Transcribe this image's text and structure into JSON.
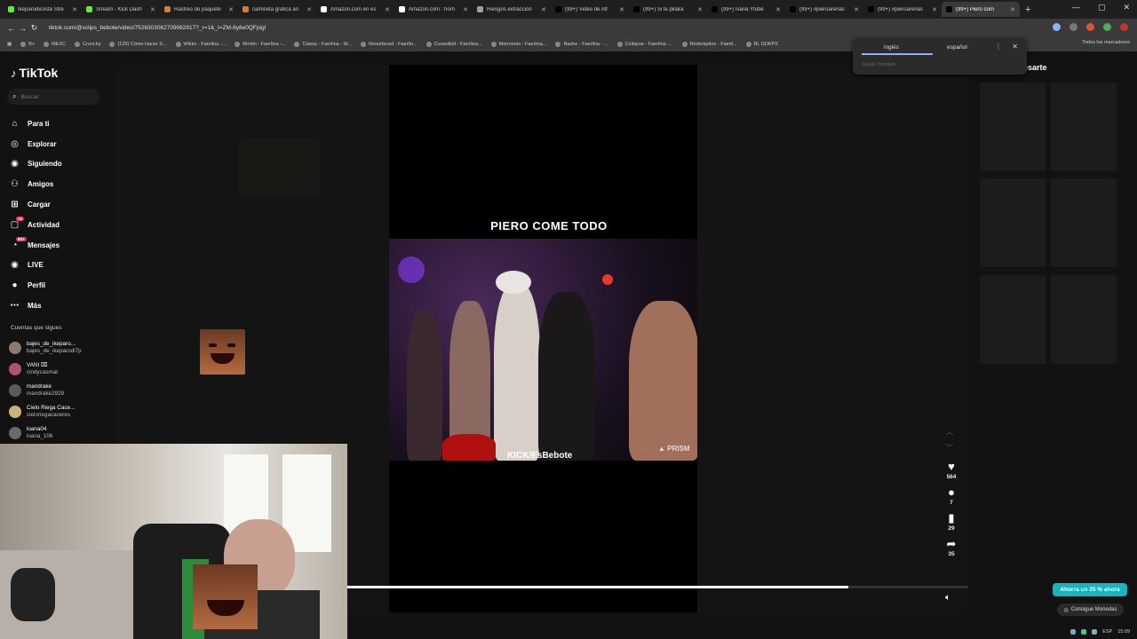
{
  "browser": {
    "tabs": [
      {
        "title": "Ikeparodicosta Stre",
        "color": "#53fc18"
      },
      {
        "title": "Stream - Kick Dash",
        "color": "#53fc18"
      },
      {
        "title": "Rastreo de paquete",
        "color": "#e8732b"
      },
      {
        "title": "camiseta gráfica an",
        "color": "#e8732b"
      },
      {
        "title": "Amazon.com en es",
        "color": "#ffffff"
      },
      {
        "title": "Amazon.com : horn",
        "color": "#ffffff"
      },
      {
        "title": "Riesgos extracción",
        "color": "#9aa0a6"
      },
      {
        "title": "(99+) Video de Alf",
        "color": "#000000"
      },
      {
        "title": "(99+) Si te pillara",
        "color": "#000000"
      },
      {
        "title": "(99+) Ivana Ytube",
        "color": "#000000"
      },
      {
        "title": "(99+) #pieroarenas",
        "color": "#000000"
      },
      {
        "title": "(99+) #pieroarenas",
        "color": "#000000"
      },
      {
        "title": "(99+) Piero com",
        "color": "#000000",
        "active": true
      }
    ],
    "url": "tiktok.com/@xclips_bebote/video/7528303062709062917?_r=1&_t=ZM-8y8e0QFpigl",
    "bookmarks": [
      "B+",
      "MEXC",
      "Crunchy",
      "(120) Cómo Hacer S...",
      "Wikko - Faerlina -...",
      "Rinrlin - Faerlina -...",
      "Classy - Faerlina - W...",
      "Resurfaced - Faerlin...",
      "Cursedkid - Faerlina...",
      "Memorets - Faerlina...",
      "Nashe - Faerlina - ...",
      "Collapse - Faerlina -...",
      "Redemption - Faerli...",
      "BL GDKPS"
    ],
    "bookmarks_all": "Todos los marcadores"
  },
  "translate_popup": {
    "lang_from": "inglés",
    "lang_to": "español",
    "brand": "Google Translate"
  },
  "tiktok": {
    "logo": "TikTok",
    "search_placeholder": "Buscar",
    "nav": [
      {
        "label": "Para ti",
        "icon": "home-icon"
      },
      {
        "label": "Explorar",
        "icon": "compass-icon"
      },
      {
        "label": "Siguiendo",
        "icon": "following-icon"
      },
      {
        "label": "Amigos",
        "icon": "friends-icon"
      },
      {
        "label": "Cargar",
        "icon": "upload-icon"
      },
      {
        "label": "Actividad",
        "icon": "activity-icon",
        "badge": "16"
      },
      {
        "label": "Mensajes",
        "icon": "messages-icon",
        "badge": "99+"
      },
      {
        "label": "LIVE",
        "icon": "live-icon"
      },
      {
        "label": "Perfil",
        "icon": "profile-icon"
      },
      {
        "label": "Más",
        "icon": "more-icon"
      }
    ],
    "following_title": "Cuentas que sigues",
    "following": [
      {
        "name": "bajes_de_ikeparo...",
        "handle": "bajes_de_ikeparodi7p"
      },
      {
        "name": "VANI ⌧",
        "handle": "cindycasmat"
      },
      {
        "name": "mandrake",
        "handle": "mandrake2929"
      },
      {
        "name": "Cielo Riega Cace...",
        "handle": "cieloriegacaceres"
      },
      {
        "name": "loana04",
        "handle": "loana_106"
      }
    ],
    "video": {
      "title": "PIERO COME TODO",
      "watermark": "KICK/EsBebote",
      "prism": "▲ PRISM",
      "progress": 0.805
    },
    "actions": [
      {
        "icon": "heart-icon",
        "count": "564"
      },
      {
        "icon": "comment-icon",
        "count": "7"
      },
      {
        "icon": "bookmark-icon",
        "count": "29"
      },
      {
        "icon": "share-icon",
        "count": "35"
      }
    ],
    "right_title": "esarte",
    "promo": "Ahorra un 25 % ahora",
    "coins": "Consigue Monedas"
  },
  "taskbar": {
    "lang": "ESP",
    "time": "15:09"
  }
}
